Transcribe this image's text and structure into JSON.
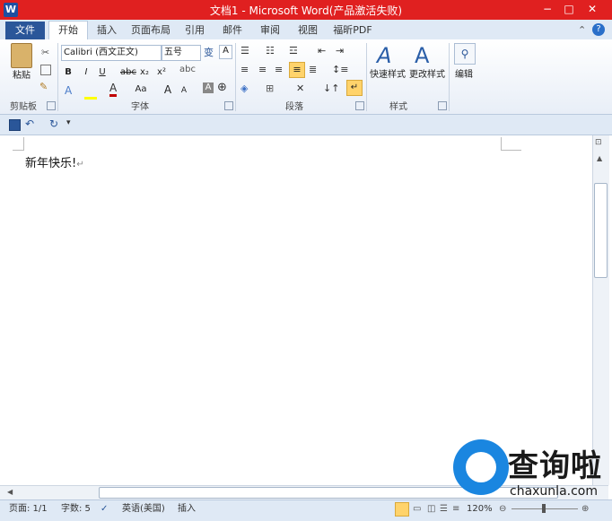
{
  "app": {
    "title": "文档1 - Microsoft Word(产品激活失败)",
    "icon_letter": "W",
    "window_controls": [
      "−",
      "□",
      "✕"
    ]
  },
  "tabs": {
    "file": "文件",
    "items": [
      "开始",
      "插入",
      "页面布局",
      "引用",
      "邮件",
      "审阅",
      "视图",
      "福昕PDF"
    ],
    "active": "开始"
  },
  "ribbon": {
    "clipboard": {
      "paste": "粘贴",
      "label": "剪贴板"
    },
    "font": {
      "font_name": "Calibri (西文正文)",
      "font_size": "五号",
      "bold": "B",
      "italic": "I",
      "underline": "U",
      "strike": "abc",
      "subscript": "x₂",
      "superscript": "x²",
      "grow": "A",
      "shrink": "A",
      "change_case": "Aa",
      "label": "字体"
    },
    "paragraph": {
      "label": "段落"
    },
    "styles": {
      "quick": "快速样式",
      "change": "更改样式",
      "label": "样式"
    },
    "editing": {
      "edit": "编辑"
    }
  },
  "document": {
    "text": "新年快乐!",
    "para_mark": "↵"
  },
  "statusbar": {
    "page": "页面: 1/1",
    "words": "字数: 5",
    "language": "英语(美国)",
    "mode": "插入",
    "zoom": "120%"
  },
  "watermark": {
    "title": "查询啦",
    "url": "chaxunla.com"
  },
  "colors": {
    "titlebar": "#e02020",
    "file_tab": "#2a5699",
    "watermark_blue": "#1a86e0"
  }
}
